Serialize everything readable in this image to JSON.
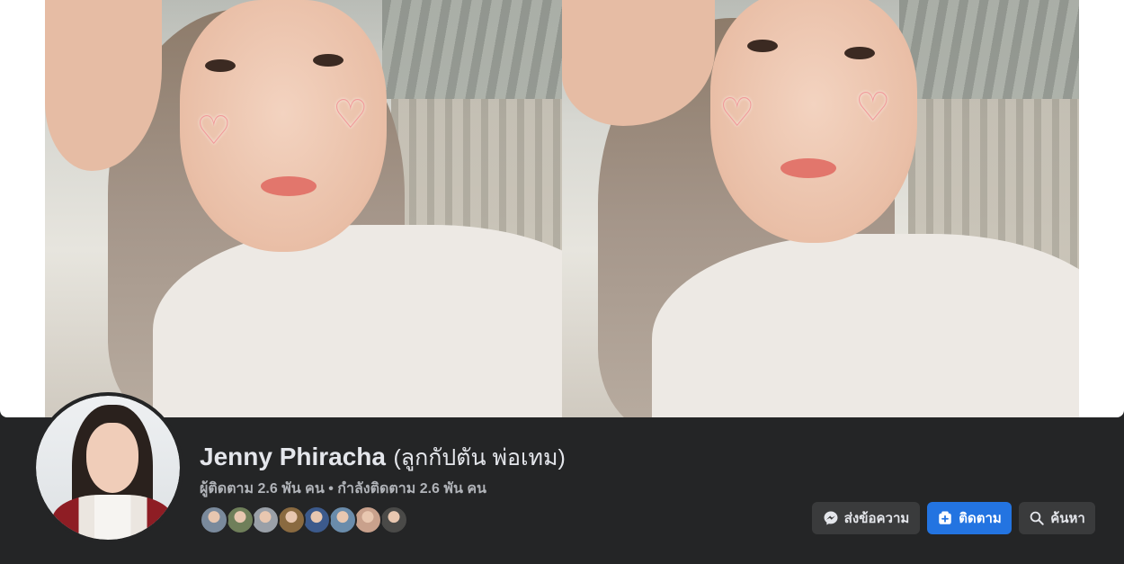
{
  "profile": {
    "name": "Jenny Phiracha",
    "alternate_name": "(ลูกกัปตัน พ่อเทม)",
    "stats": "ผู้ติดตาม 2.6 พัน คน • กำลังติดตาม 2.6 พัน คน"
  },
  "follower_avatars": [
    {
      "color": "#7a8a9c"
    },
    {
      "color": "#6f7f5a"
    },
    {
      "color": "#9aa0a8"
    },
    {
      "color": "#8a6a40"
    },
    {
      "color": "#3c5a8c"
    },
    {
      "color": "#6a8cab"
    },
    {
      "color": "#c9a18c"
    },
    {
      "color": "#4a4a48"
    }
  ],
  "actions": {
    "message_label": "ส่งข้อความ",
    "follow_label": "ติดตาม",
    "search_label": "ค้นหา"
  },
  "colors": {
    "primary_button": "#2374e1",
    "secondary_button": "#3a3b3c",
    "background": "#242526"
  },
  "icons": {
    "message": "messenger-icon",
    "follow": "follow-plus-icon",
    "search": "search-icon"
  }
}
